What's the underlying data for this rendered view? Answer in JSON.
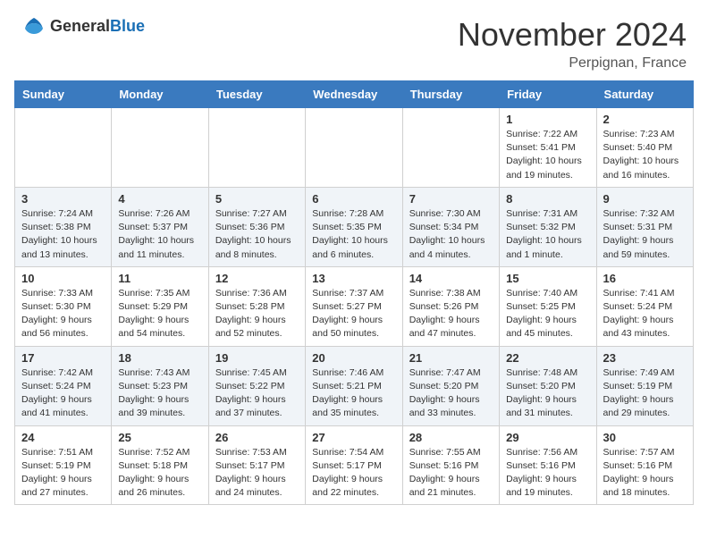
{
  "header": {
    "logo": {
      "general": "General",
      "blue": "Blue"
    },
    "title": "November 2024",
    "location": "Perpignan, France"
  },
  "calendar": {
    "days_of_week": [
      "Sunday",
      "Monday",
      "Tuesday",
      "Wednesday",
      "Thursday",
      "Friday",
      "Saturday"
    ],
    "weeks": [
      [
        {
          "day": "",
          "info": ""
        },
        {
          "day": "",
          "info": ""
        },
        {
          "day": "",
          "info": ""
        },
        {
          "day": "",
          "info": ""
        },
        {
          "day": "",
          "info": ""
        },
        {
          "day": "1",
          "info": "Sunrise: 7:22 AM\nSunset: 5:41 PM\nDaylight: 10 hours and 19 minutes."
        },
        {
          "day": "2",
          "info": "Sunrise: 7:23 AM\nSunset: 5:40 PM\nDaylight: 10 hours and 16 minutes."
        }
      ],
      [
        {
          "day": "3",
          "info": "Sunrise: 7:24 AM\nSunset: 5:38 PM\nDaylight: 10 hours and 13 minutes."
        },
        {
          "day": "4",
          "info": "Sunrise: 7:26 AM\nSunset: 5:37 PM\nDaylight: 10 hours and 11 minutes."
        },
        {
          "day": "5",
          "info": "Sunrise: 7:27 AM\nSunset: 5:36 PM\nDaylight: 10 hours and 8 minutes."
        },
        {
          "day": "6",
          "info": "Sunrise: 7:28 AM\nSunset: 5:35 PM\nDaylight: 10 hours and 6 minutes."
        },
        {
          "day": "7",
          "info": "Sunrise: 7:30 AM\nSunset: 5:34 PM\nDaylight: 10 hours and 4 minutes."
        },
        {
          "day": "8",
          "info": "Sunrise: 7:31 AM\nSunset: 5:32 PM\nDaylight: 10 hours and 1 minute."
        },
        {
          "day": "9",
          "info": "Sunrise: 7:32 AM\nSunset: 5:31 PM\nDaylight: 9 hours and 59 minutes."
        }
      ],
      [
        {
          "day": "10",
          "info": "Sunrise: 7:33 AM\nSunset: 5:30 PM\nDaylight: 9 hours and 56 minutes."
        },
        {
          "day": "11",
          "info": "Sunrise: 7:35 AM\nSunset: 5:29 PM\nDaylight: 9 hours and 54 minutes."
        },
        {
          "day": "12",
          "info": "Sunrise: 7:36 AM\nSunset: 5:28 PM\nDaylight: 9 hours and 52 minutes."
        },
        {
          "day": "13",
          "info": "Sunrise: 7:37 AM\nSunset: 5:27 PM\nDaylight: 9 hours and 50 minutes."
        },
        {
          "day": "14",
          "info": "Sunrise: 7:38 AM\nSunset: 5:26 PM\nDaylight: 9 hours and 47 minutes."
        },
        {
          "day": "15",
          "info": "Sunrise: 7:40 AM\nSunset: 5:25 PM\nDaylight: 9 hours and 45 minutes."
        },
        {
          "day": "16",
          "info": "Sunrise: 7:41 AM\nSunset: 5:24 PM\nDaylight: 9 hours and 43 minutes."
        }
      ],
      [
        {
          "day": "17",
          "info": "Sunrise: 7:42 AM\nSunset: 5:24 PM\nDaylight: 9 hours and 41 minutes."
        },
        {
          "day": "18",
          "info": "Sunrise: 7:43 AM\nSunset: 5:23 PM\nDaylight: 9 hours and 39 minutes."
        },
        {
          "day": "19",
          "info": "Sunrise: 7:45 AM\nSunset: 5:22 PM\nDaylight: 9 hours and 37 minutes."
        },
        {
          "day": "20",
          "info": "Sunrise: 7:46 AM\nSunset: 5:21 PM\nDaylight: 9 hours and 35 minutes."
        },
        {
          "day": "21",
          "info": "Sunrise: 7:47 AM\nSunset: 5:20 PM\nDaylight: 9 hours and 33 minutes."
        },
        {
          "day": "22",
          "info": "Sunrise: 7:48 AM\nSunset: 5:20 PM\nDaylight: 9 hours and 31 minutes."
        },
        {
          "day": "23",
          "info": "Sunrise: 7:49 AM\nSunset: 5:19 PM\nDaylight: 9 hours and 29 minutes."
        }
      ],
      [
        {
          "day": "24",
          "info": "Sunrise: 7:51 AM\nSunset: 5:19 PM\nDaylight: 9 hours and 27 minutes."
        },
        {
          "day": "25",
          "info": "Sunrise: 7:52 AM\nSunset: 5:18 PM\nDaylight: 9 hours and 26 minutes."
        },
        {
          "day": "26",
          "info": "Sunrise: 7:53 AM\nSunset: 5:17 PM\nDaylight: 9 hours and 24 minutes."
        },
        {
          "day": "27",
          "info": "Sunrise: 7:54 AM\nSunset: 5:17 PM\nDaylight: 9 hours and 22 minutes."
        },
        {
          "day": "28",
          "info": "Sunrise: 7:55 AM\nSunset: 5:16 PM\nDaylight: 9 hours and 21 minutes."
        },
        {
          "day": "29",
          "info": "Sunrise: 7:56 AM\nSunset: 5:16 PM\nDaylight: 9 hours and 19 minutes."
        },
        {
          "day": "30",
          "info": "Sunrise: 7:57 AM\nSunset: 5:16 PM\nDaylight: 9 hours and 18 minutes."
        }
      ]
    ]
  }
}
